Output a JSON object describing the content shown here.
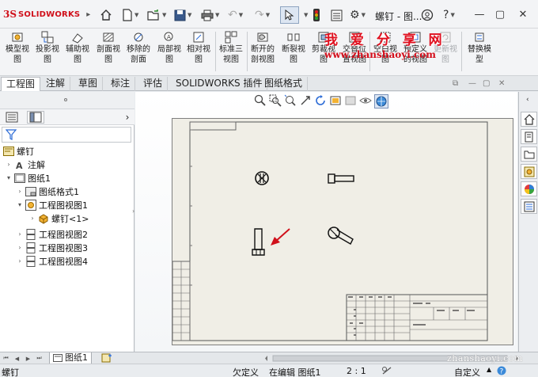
{
  "app": {
    "brand": "SOLIDWORKS",
    "title": "螺钉 - 图..."
  },
  "ribbon": {
    "buttons": [
      {
        "id": "model-view",
        "label": "模型视图"
      },
      {
        "id": "projected-view",
        "label": "投影视图"
      },
      {
        "id": "auxiliary-view",
        "label": "辅助视图"
      },
      {
        "id": "section-view",
        "label": "剖面视图"
      },
      {
        "id": "removed-section",
        "label": "移除的剖面"
      },
      {
        "id": "detail-view",
        "label": "局部视图"
      },
      {
        "id": "relative-view",
        "label": "相对视图"
      },
      {
        "id": "standard-3-view",
        "label": "标准三视图"
      },
      {
        "id": "broken-out-section",
        "label": "断开的剖视图"
      },
      {
        "id": "break",
        "label": "断裂视图"
      },
      {
        "id": "crop-view",
        "label": "剪裁视图"
      },
      {
        "id": "alternate-position",
        "label": "交替位置视图"
      },
      {
        "id": "empty-view",
        "label": "空白视图"
      },
      {
        "id": "predefined-view",
        "label": "预定义的视图"
      },
      {
        "id": "update-views",
        "label": "更新视图",
        "disabled": true
      },
      {
        "id": "replace-model",
        "label": "替换模型"
      }
    ],
    "watermark": "我 爱 分 享 网",
    "watermark_url": "www.zhanshaoyi.com"
  },
  "tabs": [
    {
      "label": "工程图",
      "active": true
    },
    {
      "label": "注解"
    },
    {
      "label": "草图"
    },
    {
      "label": "标注"
    },
    {
      "label": "评估"
    },
    {
      "label": "SOLIDWORKS 插件"
    },
    {
      "label": "图纸格式"
    }
  ],
  "tree": {
    "root": "螺钉",
    "items": [
      {
        "label": "注解"
      },
      {
        "label": "图纸1"
      },
      {
        "label": "图纸格式1"
      },
      {
        "label": "工程图视图1"
      },
      {
        "label": "螺钉<1>"
      },
      {
        "label": "工程图视图2"
      },
      {
        "label": "工程图视图3"
      },
      {
        "label": "工程图视图4"
      }
    ]
  },
  "sheet_tabs": {
    "active": "图纸1"
  },
  "status": {
    "definition": "欠定义",
    "editing": "在编辑 图纸1",
    "scale": "2 : 1",
    "custom": "自定义",
    "watermark2": "zhanshaoyi.com"
  },
  "colors": {
    "accent_red": "#d0101b",
    "watermark_red": "#e0101f",
    "sheet_bg": "#f0eee6"
  }
}
